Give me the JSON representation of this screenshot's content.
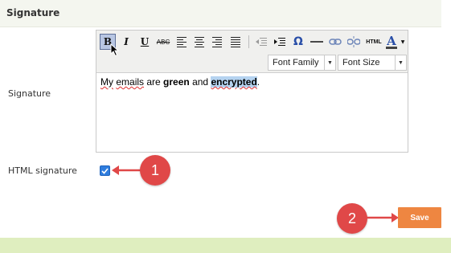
{
  "section": {
    "title": "Signature"
  },
  "form": {
    "signature_label": "Signature",
    "html_signature_label": "HTML signature",
    "html_signature_checked": true
  },
  "toolbar": {
    "bold": "B",
    "italic": "I",
    "underline": "U",
    "strike": "ABC",
    "html": "HTML",
    "omega": "Ω",
    "font_family": "Font Family",
    "font_size": "Font Size",
    "text_color": "A"
  },
  "editor_content": {
    "t1": "My",
    "t2": " ",
    "t3": "emails",
    "t4": " are ",
    "t5": "green",
    "t6": " and ",
    "t7": "encrypted",
    "t8": "."
  },
  "annotations": {
    "step1": "1",
    "step2": "2"
  },
  "actions": {
    "save": "Save"
  },
  "colors": {
    "header_bg": "#f4f6ef",
    "badge": "#e04848",
    "save_button": "#ee8641",
    "checkbox": "#2f7dde",
    "footer_band": "#dfeebf",
    "selection": "#b5d3f0"
  }
}
